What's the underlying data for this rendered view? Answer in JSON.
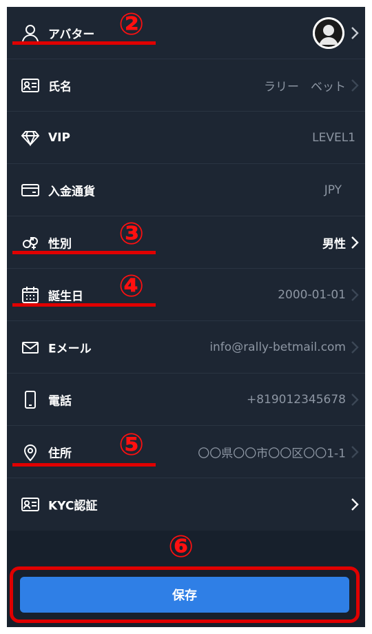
{
  "rows": [
    {
      "label": "アバター",
      "value": "",
      "icon": "person-icon"
    },
    {
      "label": "氏名",
      "value": "ラリー　ベット",
      "icon": "id-card-icon"
    },
    {
      "label": "VIP",
      "value": "LEVEL1",
      "icon": "diamond-icon"
    },
    {
      "label": "入金通貨",
      "value": "JPY",
      "icon": "card-icon"
    },
    {
      "label": "性別",
      "value": "男性",
      "icon": "gender-icon"
    },
    {
      "label": "誕生日",
      "value": "2000-01-01",
      "icon": "calendar-icon"
    },
    {
      "label": "Eメール",
      "value": "info@rally-betmail.com",
      "icon": "mail-icon"
    },
    {
      "label": "電話",
      "value": "+819012345678",
      "icon": "phone-icon"
    },
    {
      "label": "住所",
      "value": "〇〇県〇〇市〇〇区〇〇1-1",
      "icon": "location-pin-icon"
    },
    {
      "label": "KYC認証",
      "value": "",
      "icon": "kyc-card-icon"
    }
  ],
  "annotations": {
    "m2": "②",
    "m3": "③",
    "m4": "④",
    "m5": "⑤",
    "m6": "⑥"
  },
  "save_button": {
    "label": "保存"
  },
  "colors": {
    "background": "#1d2633",
    "accent_button": "#2f7fe6",
    "annotation_red": "#e00000"
  }
}
